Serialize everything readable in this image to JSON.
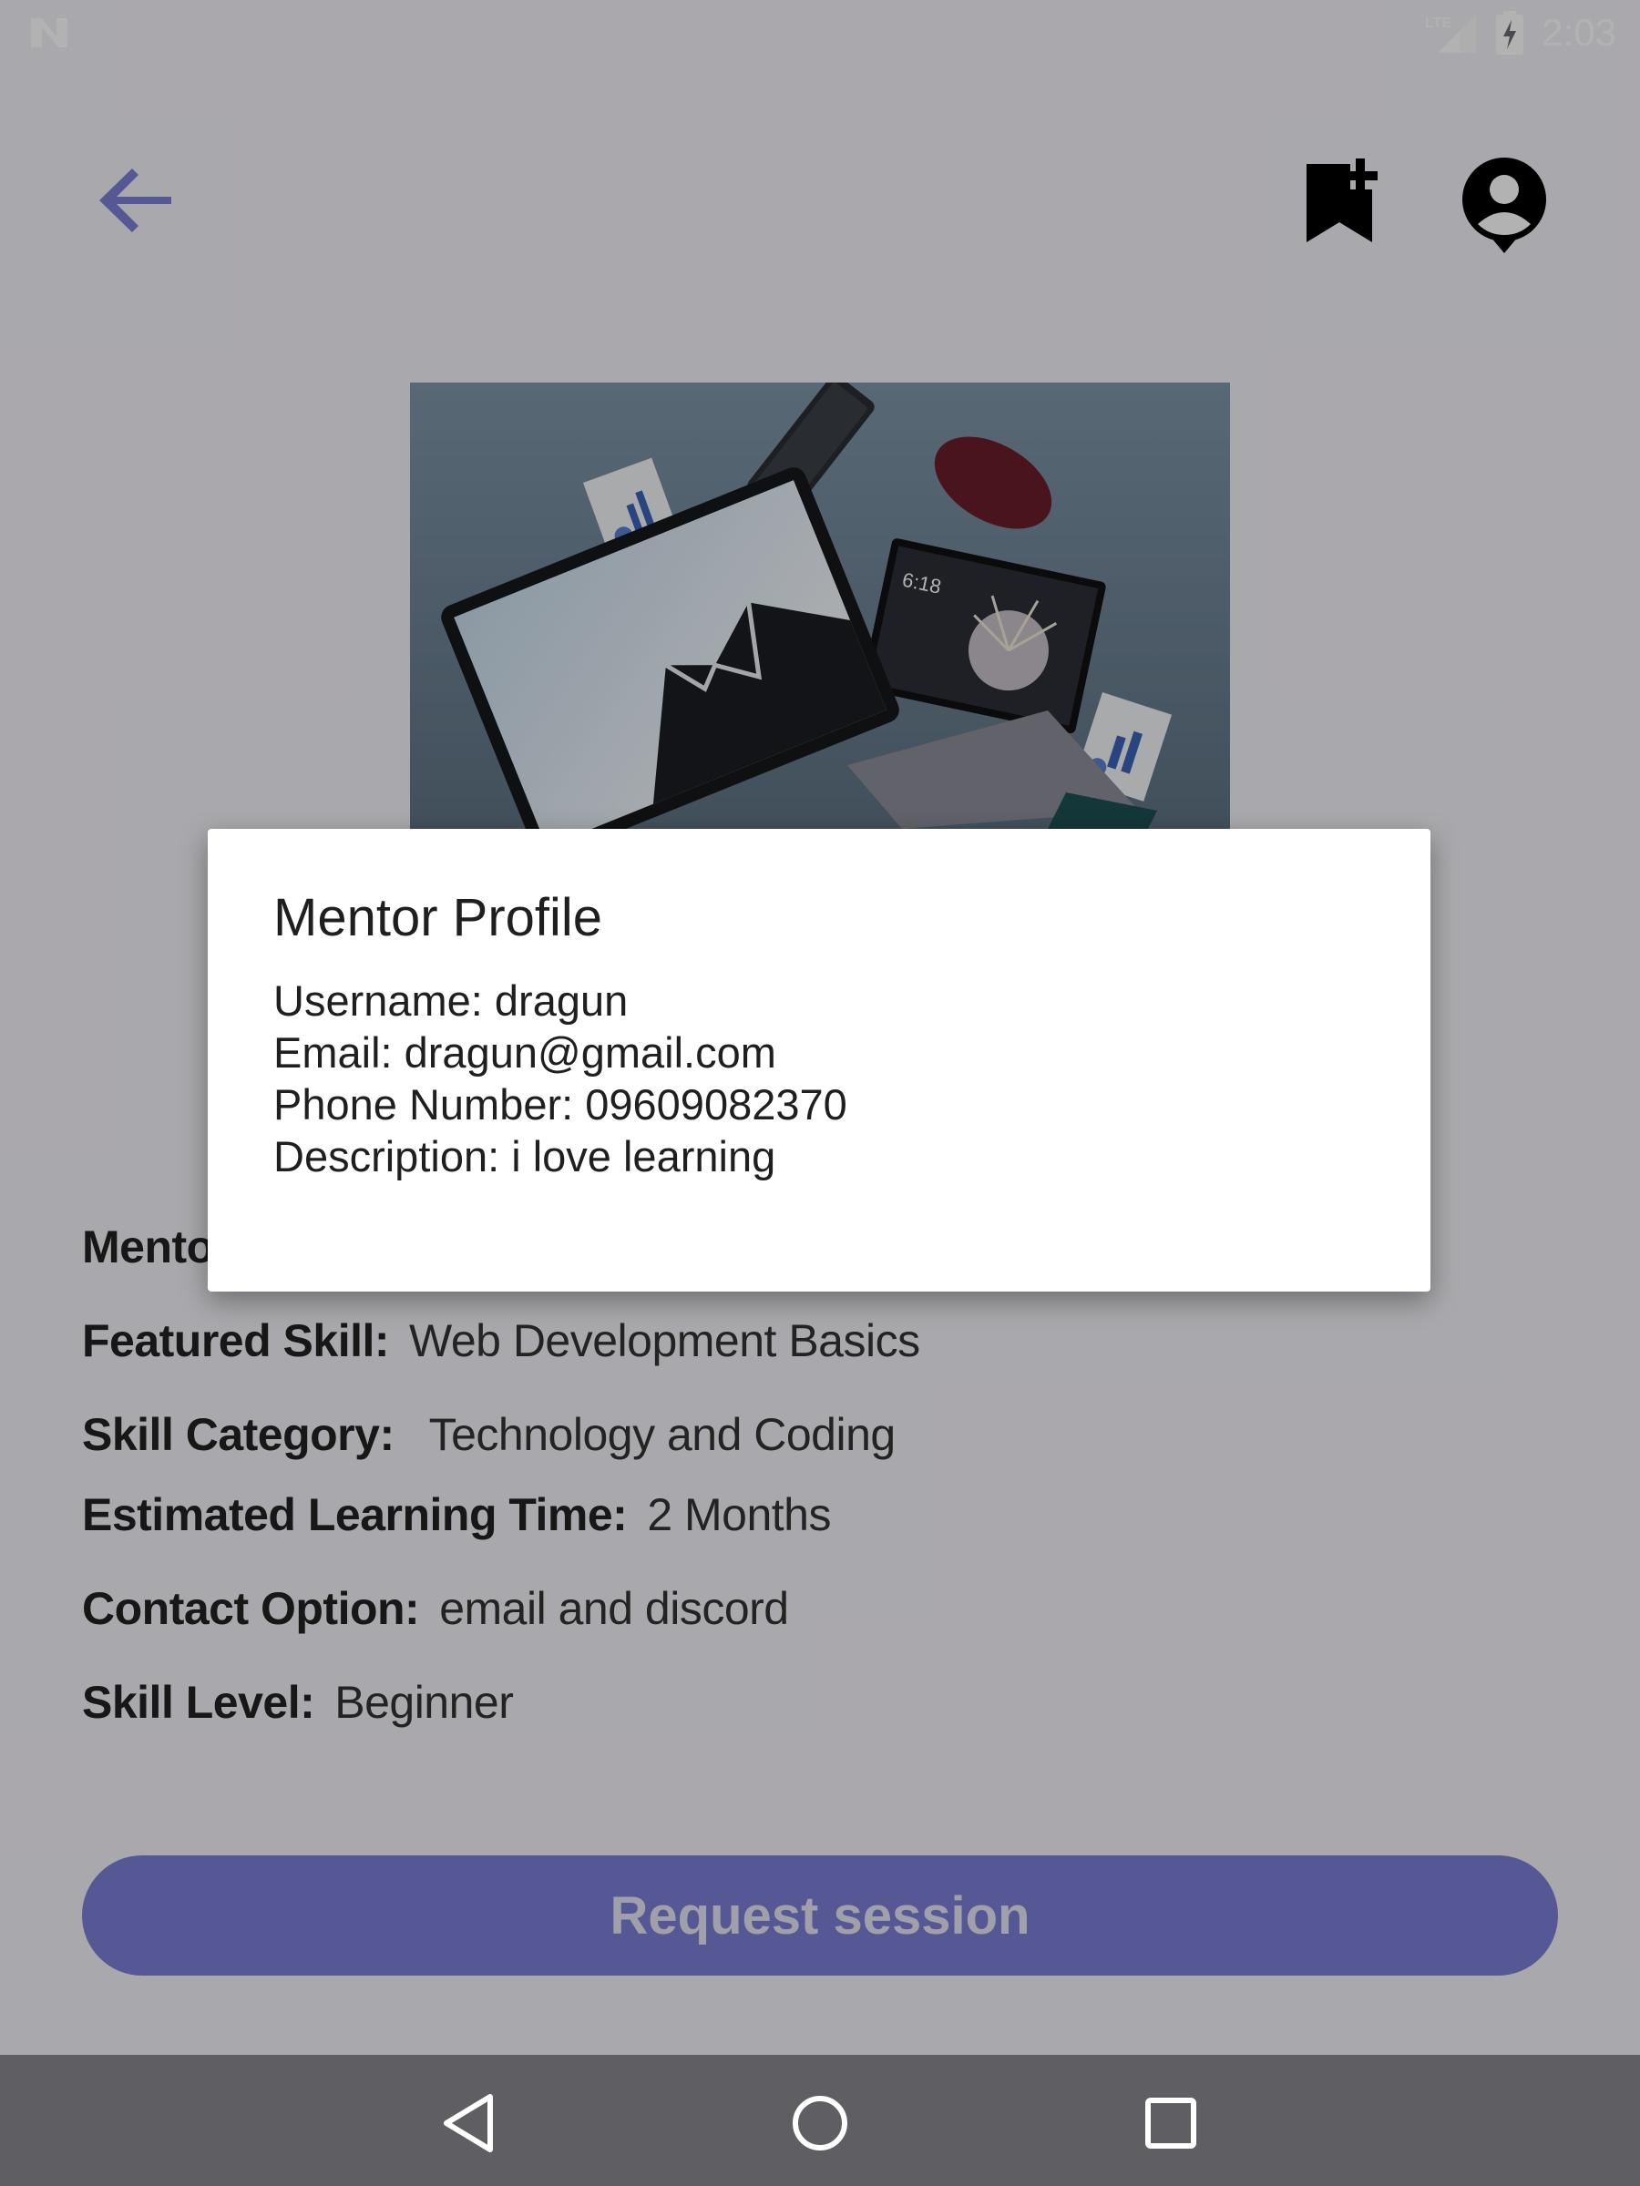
{
  "status_bar": {
    "left_icon": "notification-n-icon",
    "network": "LTE",
    "time": "2:03"
  },
  "app_bar": {
    "back_icon": "arrow-back-icon",
    "bookmark_icon": "bookmark-add-icon",
    "account_icon": "account-icon"
  },
  "details": {
    "mentor_label_partial": "Mento",
    "featured_skill_label": "Featured Skill:",
    "featured_skill_value": "Web Development Basics",
    "skill_category_label": "Skill Category:",
    "skill_category_value": "Technology and Coding",
    "learning_time_label": "Estimated Learning Time:",
    "learning_time_value": "2 Months",
    "contact_label": "Contact Option:",
    "contact_value": "email and discord",
    "skill_level_label": "Skill Level:",
    "skill_level_value": "Beginner"
  },
  "request_button": "Request session",
  "dialog": {
    "title": "Mentor Profile",
    "username": "Username: dragun",
    "email": "Email: dragun@gmail.com",
    "phone": "Phone Number: 09609082370",
    "description": "Description: i love learning"
  },
  "colors": {
    "accent": "#7b7ed6",
    "back_arrow": "#7b7ed6",
    "scrim": "rgba(0,0,0,0.30)",
    "nav_bar": "#5f5e62"
  }
}
